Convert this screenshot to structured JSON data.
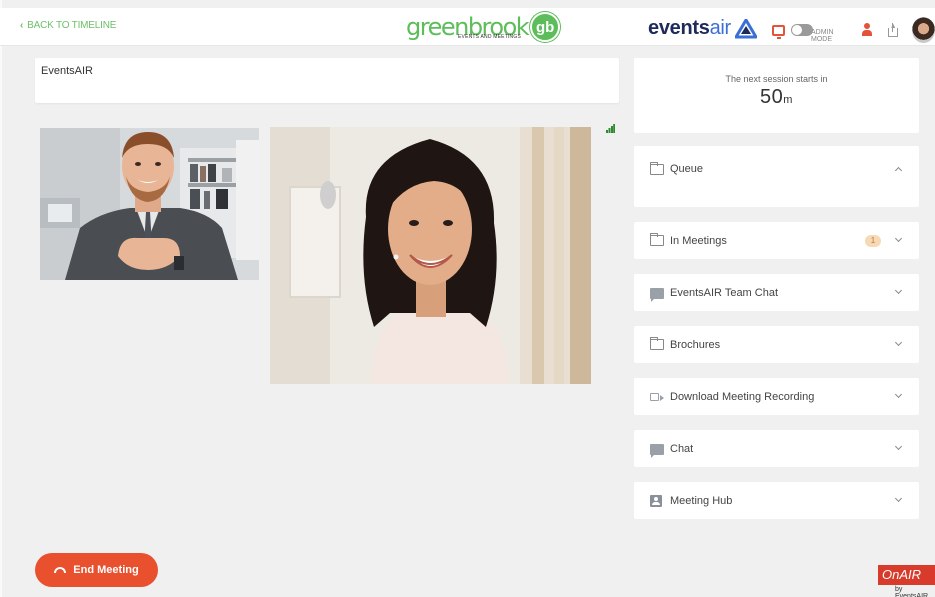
{
  "header": {
    "back_label": "BACK TO TIMELINE",
    "center_brand": "greenbrook",
    "center_brand_sub": "EVENTS AND MEETINGS",
    "center_badge": "gb",
    "right_brand_bold": "events",
    "right_brand_light": "air",
    "admin_mode_label": "ADMIN MODE",
    "admin_mode_on": false
  },
  "meeting": {
    "title": "EventsAIR",
    "end_button_label": "End Meeting"
  },
  "next_session": {
    "label": "The next session starts in",
    "value": "50",
    "unit": "m"
  },
  "panels": [
    {
      "label": "Queue",
      "icon": "folder-icon",
      "expanded": true
    },
    {
      "label": "In Meetings",
      "icon": "folder-icon",
      "badge": "1"
    },
    {
      "label": "EventsAIR Team Chat",
      "icon": "chat-icon"
    },
    {
      "label": "Brochures",
      "icon": "folder-icon"
    },
    {
      "label": "Download Meeting Recording",
      "icon": "camera-icon"
    },
    {
      "label": "Chat",
      "icon": "chat-icon"
    },
    {
      "label": "Meeting Hub",
      "icon": "hub-icon"
    }
  ],
  "footer": {
    "onair_logo": "OnAIR",
    "onair_sub": "by EventsAIR"
  },
  "colors": {
    "accent_green": "#5cbd5a",
    "accent_red": "#e8502e",
    "brand_navy": "#1e2a5a",
    "brand_blue": "#3b6fd8"
  }
}
